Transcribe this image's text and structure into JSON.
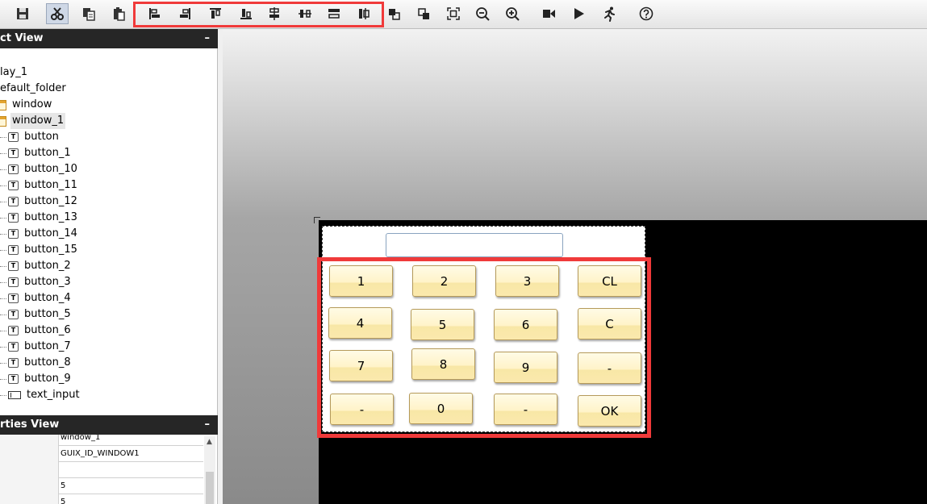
{
  "toolbar": {
    "buttons": [
      {
        "name": "save-icon"
      },
      {
        "name": "cut-icon"
      },
      {
        "name": "copy-icon"
      },
      {
        "name": "paste-icon"
      },
      {
        "name": "align-left-icon"
      },
      {
        "name": "align-right-icon"
      },
      {
        "name": "align-top-icon"
      },
      {
        "name": "align-bottom-icon"
      },
      {
        "name": "align-center-vertical-icon"
      },
      {
        "name": "distribute-horizontal-icon"
      },
      {
        "name": "align-center-horizontal-icon"
      },
      {
        "name": "distribute-vertical-icon"
      },
      {
        "name": "bring-to-front-icon"
      },
      {
        "name": "send-to-back-icon"
      },
      {
        "name": "fit-to-window-icon"
      },
      {
        "name": "zoom-out-icon"
      },
      {
        "name": "zoom-in-icon"
      },
      {
        "name": "record-macro-icon"
      },
      {
        "name": "run-icon"
      },
      {
        "name": "run-application-icon"
      },
      {
        "name": "help-icon"
      }
    ]
  },
  "project_view": {
    "title": "ct View",
    "minimize": "–",
    "tree": [
      {
        "label": "lay_1",
        "icon": "none"
      },
      {
        "label": "efault_folder",
        "icon": "none"
      },
      {
        "label": "window",
        "icon": "window-icon"
      },
      {
        "label": "window_1",
        "icon": "window-icon",
        "selected": true
      },
      {
        "label": "button",
        "icon": "button-icon"
      },
      {
        "label": "button_1",
        "icon": "button-icon"
      },
      {
        "label": "button_10",
        "icon": "button-icon"
      },
      {
        "label": "button_11",
        "icon": "button-icon"
      },
      {
        "label": "button_12",
        "icon": "button-icon"
      },
      {
        "label": "button_13",
        "icon": "button-icon"
      },
      {
        "label": "button_14",
        "icon": "button-icon"
      },
      {
        "label": "button_15",
        "icon": "button-icon"
      },
      {
        "label": "button_2",
        "icon": "button-icon"
      },
      {
        "label": "button_3",
        "icon": "button-icon"
      },
      {
        "label": "button_4",
        "icon": "button-icon"
      },
      {
        "label": "button_5",
        "icon": "button-icon"
      },
      {
        "label": "button_6",
        "icon": "button-icon"
      },
      {
        "label": "button_7",
        "icon": "button-icon"
      },
      {
        "label": "button_8",
        "icon": "button-icon"
      },
      {
        "label": "button_9",
        "icon": "button-icon"
      },
      {
        "label": "text_input",
        "icon": "text-input-icon"
      }
    ],
    "button_icon_glyph": "T"
  },
  "properties_view": {
    "title": "rties View",
    "minimize": "–",
    "rows": [
      "window_1",
      "GUIX_ID_WINDOW1",
      "",
      "5",
      "5"
    ]
  },
  "keypad": {
    "keys": [
      "1",
      "2",
      "3",
      "CL",
      "4",
      "5",
      "6",
      "C",
      "7",
      "8",
      "9",
      "-",
      "-",
      "0",
      "-",
      "OK"
    ]
  }
}
